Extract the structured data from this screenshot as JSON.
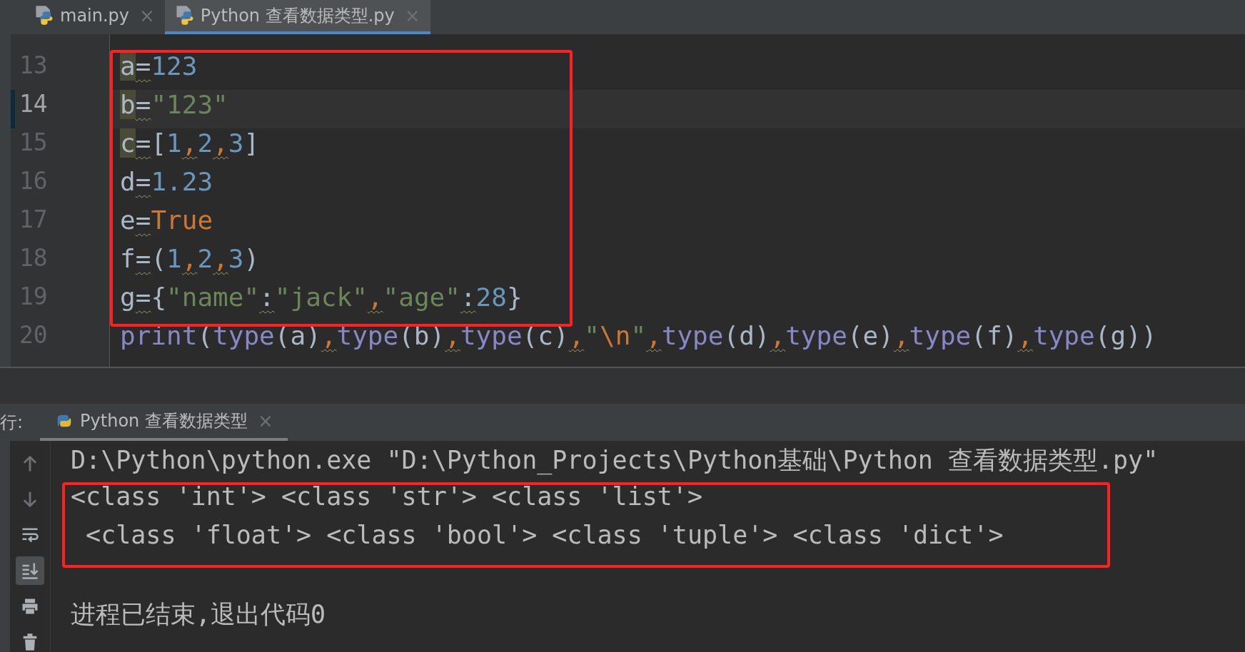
{
  "tabs": [
    {
      "label": "main.py",
      "close": "×",
      "selected": false
    },
    {
      "label": "Python 查看数据类型.py",
      "close": "×",
      "selected": true
    }
  ],
  "editor": {
    "lines": [
      {
        "number": "13",
        "current": false,
        "tokens": [
          {
            "text": "a",
            "kind": "ident",
            "mark": true
          },
          {
            "text": "=",
            "kind": "op",
            "warn": true
          },
          {
            "text": "123",
            "kind": "num"
          }
        ]
      },
      {
        "number": "14",
        "current": true,
        "tokens": [
          {
            "text": "b",
            "kind": "ident",
            "mark": true
          },
          {
            "text": "=",
            "kind": "op",
            "warn": true
          },
          {
            "text": "\"123\"",
            "kind": "str"
          }
        ]
      },
      {
        "number": "15",
        "current": false,
        "tokens": [
          {
            "text": "c",
            "kind": "ident",
            "mark": true
          },
          {
            "text": "=",
            "kind": "op",
            "warn": true
          },
          {
            "text": "[",
            "kind": "punct"
          },
          {
            "text": "1",
            "kind": "num"
          },
          {
            "text": ",",
            "kind": "comma",
            "warn": true
          },
          {
            "text": "2",
            "kind": "num"
          },
          {
            "text": ",",
            "kind": "comma",
            "warn": true
          },
          {
            "text": "3",
            "kind": "num"
          },
          {
            "text": "]",
            "kind": "punct"
          }
        ]
      },
      {
        "number": "16",
        "current": false,
        "tokens": [
          {
            "text": "d",
            "kind": "ident"
          },
          {
            "text": "=",
            "kind": "op",
            "warn": true
          },
          {
            "text": "1.23",
            "kind": "num"
          }
        ]
      },
      {
        "number": "17",
        "current": false,
        "tokens": [
          {
            "text": "e",
            "kind": "ident"
          },
          {
            "text": "=",
            "kind": "op",
            "warn": true
          },
          {
            "text": "True",
            "kind": "kw"
          }
        ]
      },
      {
        "number": "18",
        "current": false,
        "tokens": [
          {
            "text": "f",
            "kind": "ident"
          },
          {
            "text": "=",
            "kind": "op",
            "warn": true
          },
          {
            "text": "(",
            "kind": "punct"
          },
          {
            "text": "1",
            "kind": "num"
          },
          {
            "text": ",",
            "kind": "comma",
            "warn": true
          },
          {
            "text": "2",
            "kind": "num"
          },
          {
            "text": ",",
            "kind": "comma",
            "warn": true
          },
          {
            "text": "3",
            "kind": "num"
          },
          {
            "text": ")",
            "kind": "punct"
          }
        ]
      },
      {
        "number": "19",
        "current": false,
        "tokens": [
          {
            "text": "g",
            "kind": "ident"
          },
          {
            "text": "=",
            "kind": "op",
            "warn": true
          },
          {
            "text": "{",
            "kind": "punct"
          },
          {
            "text": "\"name\"",
            "kind": "str"
          },
          {
            "text": ":",
            "kind": "op",
            "warn": true
          },
          {
            "text": "\"jack\"",
            "kind": "str"
          },
          {
            "text": ",",
            "kind": "comma",
            "warn": true
          },
          {
            "text": "\"age\"",
            "kind": "str"
          },
          {
            "text": ":",
            "kind": "op",
            "warn": true
          },
          {
            "text": "28",
            "kind": "num"
          },
          {
            "text": "}",
            "kind": "punct"
          }
        ]
      },
      {
        "number": "20",
        "current": false,
        "tokens": [
          {
            "text": "print",
            "kind": "call"
          },
          {
            "text": "(",
            "kind": "punct"
          },
          {
            "text": "type",
            "kind": "call"
          },
          {
            "text": "(a)",
            "kind": "punct"
          },
          {
            "text": ",",
            "kind": "comma",
            "warn": true
          },
          {
            "text": "type",
            "kind": "call"
          },
          {
            "text": "(b)",
            "kind": "punct"
          },
          {
            "text": ",",
            "kind": "comma",
            "warn": true
          },
          {
            "text": "type",
            "kind": "call"
          },
          {
            "text": "(c)",
            "kind": "punct"
          },
          {
            "text": ",",
            "kind": "comma",
            "warn": true
          },
          {
            "text": "\"",
            "kind": "str"
          },
          {
            "text": "\\n",
            "kind": "kw"
          },
          {
            "text": "\"",
            "kind": "str"
          },
          {
            "text": ",",
            "kind": "comma",
            "warn": true
          },
          {
            "text": "type",
            "kind": "call"
          },
          {
            "text": "(d)",
            "kind": "punct"
          },
          {
            "text": ",",
            "kind": "comma",
            "warn": true
          },
          {
            "text": "type",
            "kind": "call"
          },
          {
            "text": "(e)",
            "kind": "punct"
          },
          {
            "text": ",",
            "kind": "comma",
            "warn": true
          },
          {
            "text": "type",
            "kind": "call"
          },
          {
            "text": "(f)",
            "kind": "punct"
          },
          {
            "text": ",",
            "kind": "comma",
            "warn": true
          },
          {
            "text": "type",
            "kind": "call"
          },
          {
            "text": "(g))",
            "kind": "punct"
          }
        ]
      }
    ]
  },
  "run_panel": {
    "label": "行:",
    "tab": {
      "label": "Python 查看数据类型",
      "close": "×",
      "selected": true
    },
    "toolbar": [
      {
        "kind": "up",
        "on": false
      },
      {
        "kind": "down",
        "on": false
      },
      {
        "kind": "wrap",
        "on": false
      },
      {
        "kind": "scroll-end",
        "on": true
      },
      {
        "kind": "print",
        "on": false
      },
      {
        "kind": "trash",
        "on": false
      }
    ],
    "output": [
      {
        "text": "D:\\Python\\python.exe \"D:\\Python_Projects\\Python基础\\Python 查看数据类型.py\""
      },
      {
        "text": "<class 'int'> <class 'str'> <class 'list'>"
      },
      {
        "text": " <class 'float'> <class 'bool'> <class 'tuple'> <class 'dict'>"
      },
      {
        "text": "进程已结束,退出代码0"
      }
    ]
  }
}
